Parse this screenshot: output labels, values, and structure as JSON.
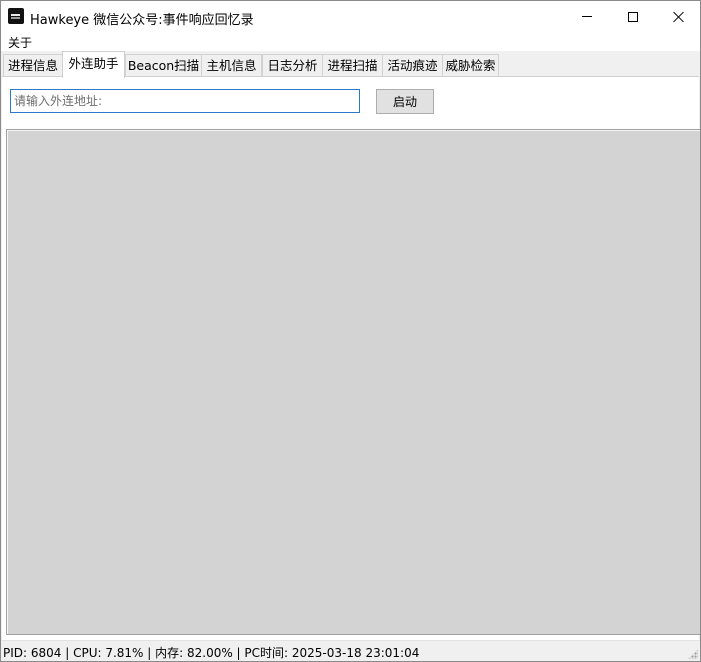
{
  "window": {
    "title": "Hawkeye 微信公众号:事件响应回忆录",
    "icon": "app-icon"
  },
  "menu": {
    "items": [
      {
        "label": "关于"
      }
    ]
  },
  "tabs": [
    {
      "label": "进程信息",
      "active": false
    },
    {
      "label": "外连助手",
      "active": true
    },
    {
      "label": "Beacon扫描",
      "active": false
    },
    {
      "label": "主机信息",
      "active": false
    },
    {
      "label": "日志分析",
      "active": false
    },
    {
      "label": "进程扫描",
      "active": false
    },
    {
      "label": "活动痕迹",
      "active": false
    },
    {
      "label": "威胁检索",
      "active": false
    }
  ],
  "connect_helper": {
    "address_input": {
      "value": "",
      "placeholder": "请输入外连地址:"
    },
    "start_button": "启动"
  },
  "statusbar": {
    "text": "PID: 6804 | CPU: 7.81% | 内存: 82.00% | PC时间: 2025-03-18 23:01:04"
  }
}
